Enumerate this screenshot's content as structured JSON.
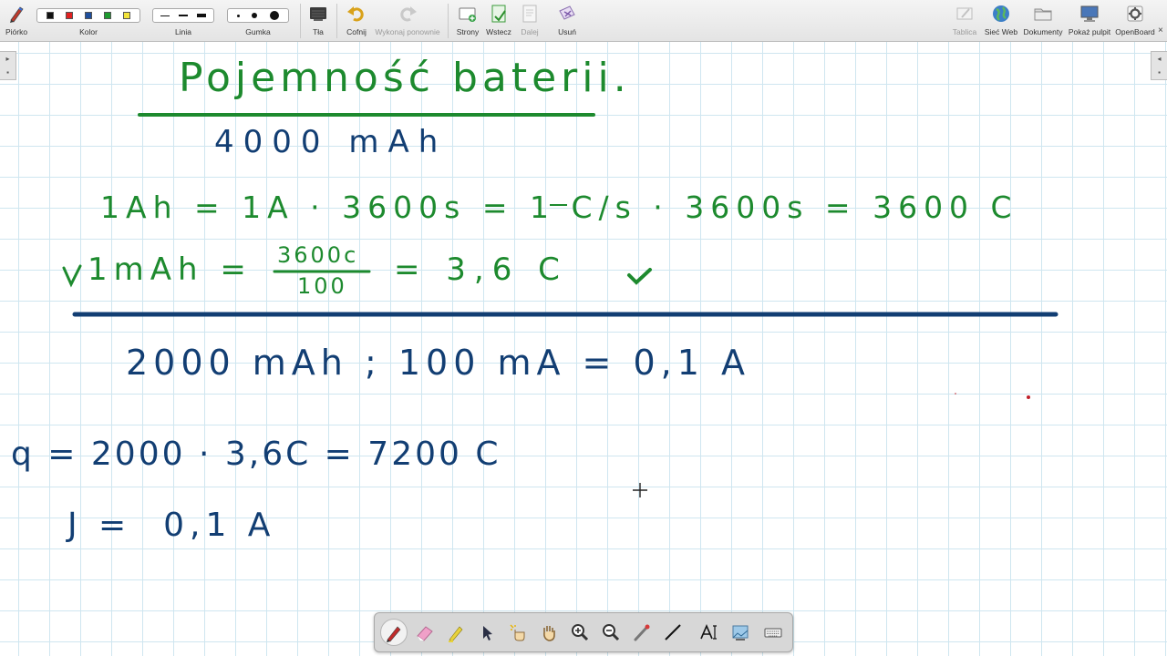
{
  "toolbar": {
    "pen": "Piórko",
    "color": "Kolor",
    "line": "Linia",
    "eraser": "Gumka",
    "background": "Tła",
    "undo": "Cofnij",
    "redo": "Wykonaj ponownie",
    "pages": "Strony",
    "back": "Wstecz",
    "next": "Dalej",
    "delete": "Usuń",
    "board": "Tablica",
    "web": "Sieć Web",
    "documents": "Dokumenty",
    "show_desktop": "Pokaż pulpit",
    "openboard": "OpenBoard"
  },
  "colors": {
    "swatches": [
      "#111111",
      "#e02020",
      "#1f4f9c",
      "#1e9a2f",
      "#f2e33a"
    ],
    "green_ink": "#1d8a2e",
    "blue_ink": "#123e73"
  },
  "board": {
    "title": "Pojemność baterii.",
    "capacity": "4000 mAh",
    "eq1": "1Ah = 1A · 3600s = 1 C/s · 3600s = 3600 C",
    "eq2_lhs": "1mAh =",
    "eq2_num": "3600c",
    "eq2_den": "100",
    "eq2_rhs": "= 3,6 C",
    "given": "2000 mAh ; 100 mA = 0,1 A",
    "charge": "q = 2000 · 3,6C = 7200 C",
    "current": "J =  0,1 A"
  },
  "palette": {
    "tools": [
      "pen-icon",
      "eraser-icon",
      "highlighter-icon",
      "selector-icon",
      "interact-icon",
      "hand-icon",
      "zoom-in-icon",
      "zoom-out-icon",
      "laser-pointer-icon",
      "line-icon",
      "text-icon",
      "capture-icon",
      "keyboard-icon"
    ],
    "active": "pen-icon"
  }
}
